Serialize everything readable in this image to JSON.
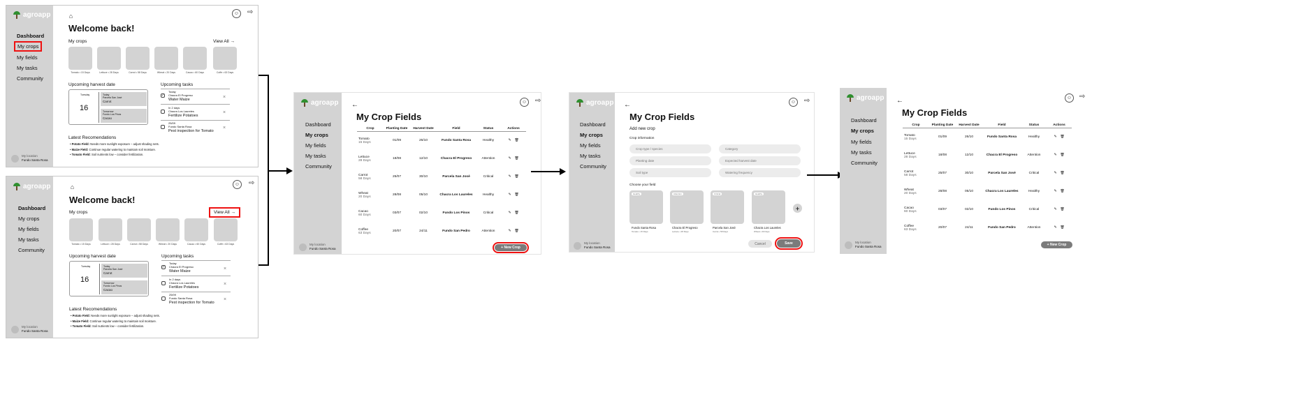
{
  "app": {
    "name": "agroapp"
  },
  "nav": [
    "Dashboard",
    "My crops",
    "My fields",
    "My tasks",
    "Community"
  ],
  "location": {
    "label": "My location",
    "name": "Fundo Santa Rosa"
  },
  "dashboard": {
    "welcome": "Welcome back!",
    "my_crops": "My crops",
    "view_all": "View All →",
    "crops": [
      "Tomato • 15 Days",
      "Lettuce • 28 Days",
      "Carrot • 58 Days",
      "Wheat • 20 Days",
      "Cacao • 60 Days",
      "Coffe • 63 Days"
    ],
    "harvest": {
      "title": "Upcoming harvest date",
      "weekday": "Tuesday",
      "day": "16",
      "items": [
        {
          "when": "Today",
          "field": "Parcela San José",
          "crop": "Carrot"
        },
        {
          "when": "Tomorrow",
          "field": "Fundo Los Pinos",
          "crop": "Cacao"
        }
      ]
    },
    "tasks": {
      "title": "Upcoming tasks",
      "items": [
        {
          "when": "Today",
          "field": "Chacra El Progreso",
          "task": "Water Maize",
          "done": true
        },
        {
          "when": "In 2 days",
          "field": "Chacra Los Laureles",
          "task": "Fertilize Potatoes",
          "done": false
        },
        {
          "when": "25/09",
          "field": "Fundo Santa Rosa",
          "task": "Pest inspection for Tomato",
          "done": false
        }
      ]
    },
    "reco": {
      "title": "Latest Recomendations",
      "items": [
        {
          "field": "Potato Field:",
          "text": " Needs more sunlight exposure – adjust shading nets."
        },
        {
          "field": "Maize Field:",
          "text": " Continue regular watering to maintain soil moisture."
        },
        {
          "field": "Tomato Field:",
          "text": " Soil nutrients low – consider fertilization."
        }
      ]
    }
  },
  "crop_fields": {
    "title": "My Crop Fields",
    "columns": [
      "Crop",
      "Planting Date",
      "Harvest Date",
      "Field",
      "Status",
      "Actions"
    ],
    "rows": [
      {
        "crop": "Tomato",
        "days": "15 Days",
        "planting": "01/09",
        "harvest": "26/10",
        "field": "Fundo Santa Rosa",
        "status": "Healthy"
      },
      {
        "crop": "Lettuce",
        "days": "28 Days",
        "planting": "18/08",
        "harvest": "12/10",
        "field": "Chacra El Progreso",
        "status": "Attention"
      },
      {
        "crop": "Carrot",
        "days": "58 Days",
        "planting": "25/07",
        "harvest": "30/10",
        "field": "Parcela San José",
        "status": "Critical"
      },
      {
        "crop": "Wheat",
        "days": "20 Days",
        "planting": "28/08",
        "harvest": "05/10",
        "field": "Chacra Los Laureles",
        "status": "Healthy"
      },
      {
        "crop": "Cacao",
        "days": "60 Days",
        "planting": "03/07",
        "harvest": "02/10",
        "field": "Fundo Los Pinos",
        "status": "Critical"
      },
      {
        "crop": "Coffee",
        "days": "63 Days",
        "planting": "20/07",
        "harvest": "24/11",
        "field": "Fundo San Pedro",
        "status": "Attention"
      }
    ],
    "new_crop": "+ New Crop"
  },
  "add_crop": {
    "title": "My Crop Fields",
    "subtitle": "Add new crop",
    "info_label": "Crop information",
    "placeholders": [
      "Crop type / species",
      "Category",
      "Planting date",
      "Expected harvest date",
      "Soil type",
      "Watering frequency"
    ],
    "choose_label": "Choose your field",
    "fields": [
      {
        "badge": "Healthy",
        "name": "Fundo Santa Rosa",
        "sub": "Tomato • 15 Days"
      },
      {
        "badge": "Attention",
        "name": "Chacra El Progreso",
        "sub": "Lettuce • 28 Days"
      },
      {
        "badge": "Critical",
        "name": "Parcela San José",
        "sub": "Carrot • 58 Days"
      },
      {
        "badge": "Healthy",
        "name": "Chacra Los Laureles",
        "sub": "Wheat • 20 Days"
      }
    ],
    "cancel": "Cancel",
    "save": "Save"
  }
}
